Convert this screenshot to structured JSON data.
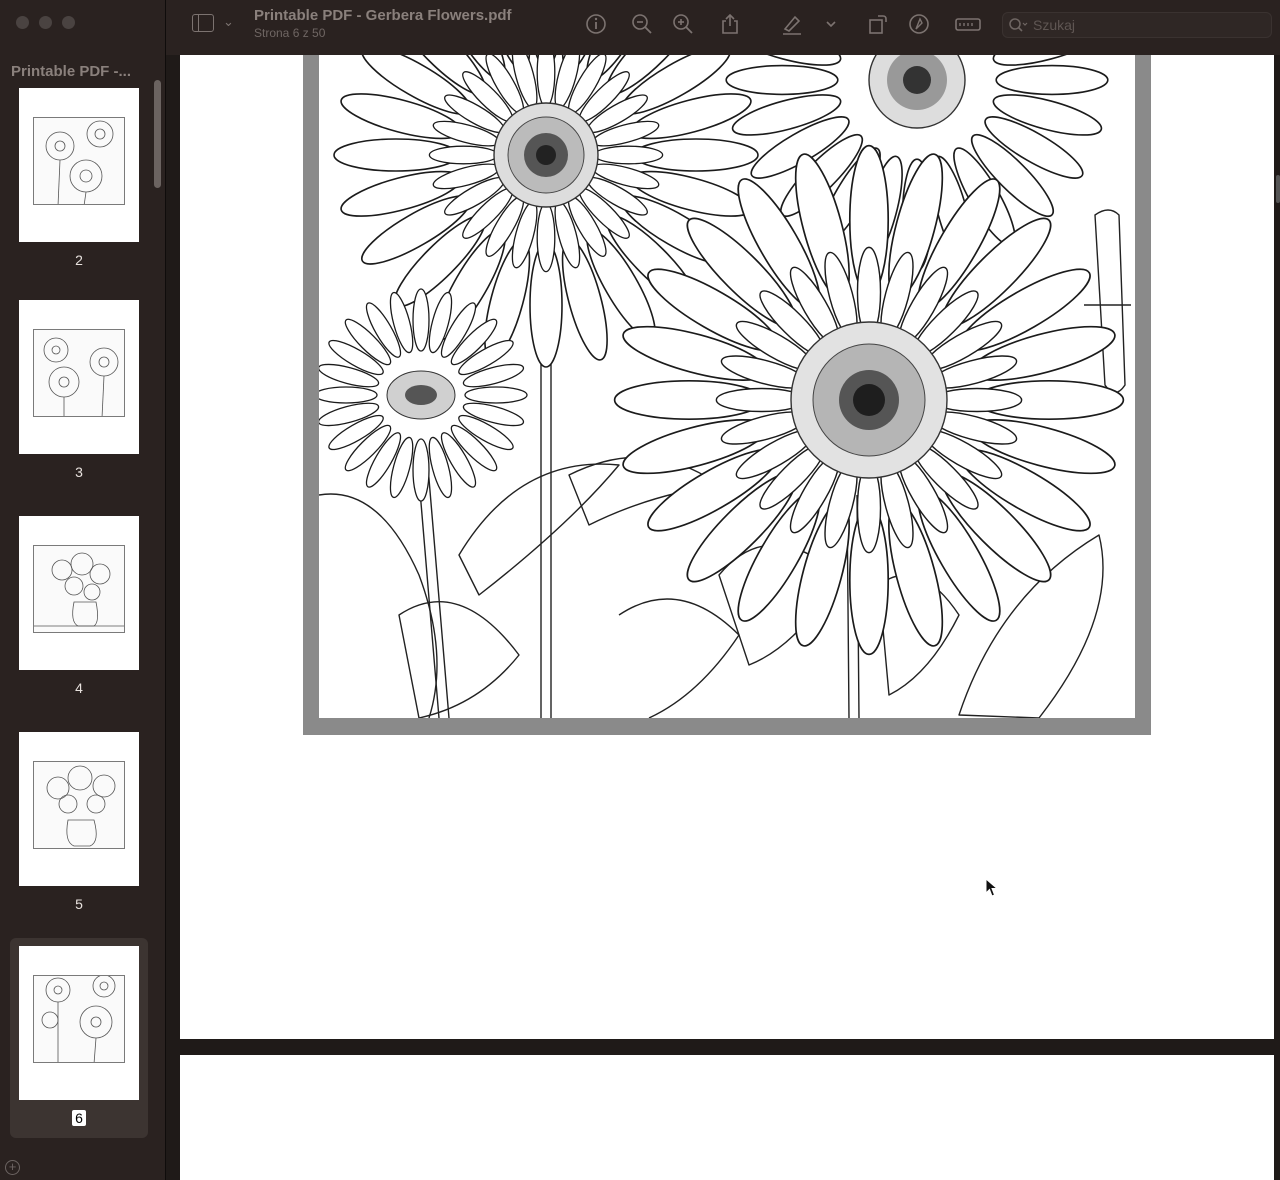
{
  "window": {
    "title": "Printable PDF - Gerbera Flowers.pdf",
    "subtitle": "Strona 6 z 50"
  },
  "sidebar": {
    "title": "Printable PDF -...",
    "thumbnails": [
      {
        "page": "2",
        "selected": false,
        "variant": "flowers-left"
      },
      {
        "page": "3",
        "selected": false,
        "variant": "flowers-wide"
      },
      {
        "page": "4",
        "selected": false,
        "variant": "vase-table"
      },
      {
        "page": "5",
        "selected": false,
        "variant": "vase-bouquet"
      },
      {
        "page": "6",
        "selected": true,
        "variant": "flowers-current"
      }
    ]
  },
  "toolbar": {
    "icons": [
      "sidebar-toggle-icon",
      "chevron-down-icon",
      "info-icon",
      "zoom-out-icon",
      "zoom-in-icon",
      "share-icon",
      "highlight-pen-icon",
      "chevron-down-icon",
      "rotate-icon",
      "markup-icon",
      "redact-icon",
      "search-icon"
    ]
  },
  "search": {
    "placeholder": "Szukaj"
  },
  "colors": {
    "chrome": "#2a2220",
    "background": "#1f1a18",
    "page": "#ffffff",
    "frame": "#8a8a8a"
  }
}
